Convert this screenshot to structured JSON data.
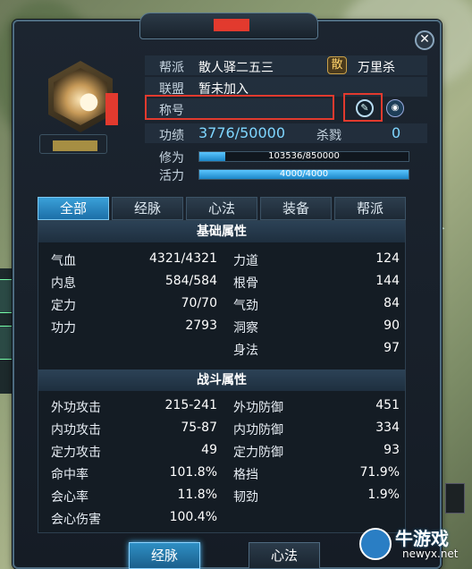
{
  "window": {
    "close_icon": "close-icon"
  },
  "profile": {
    "bangpai_label": "帮派",
    "bangpai_value": "散人驿二五三",
    "faction_badge": "散",
    "faction_name": "万里杀",
    "lianmeng_label": "联盟",
    "lianmeng_value": "暂未加入",
    "chenghao_label": "称号",
    "gongji_label": "功绩",
    "gongji_value": "3776/50000",
    "shalu_label": "杀戮",
    "shalu_value": "0",
    "xiuwei_label": "修为",
    "xiuwei_text": "103536/850000",
    "xiuwei_fraction": 0.1218,
    "huoli_label": "活力",
    "huoli_text": "4000/4000",
    "huoli_fraction": 1.0
  },
  "tabs": [
    "全部",
    "经脉",
    "心法",
    "装备",
    "帮派"
  ],
  "active_tab": 0,
  "basic": {
    "title": "基础属性",
    "left": [
      {
        "label": "气血",
        "value": "4321/4321"
      },
      {
        "label": "内息",
        "value": "584/584"
      },
      {
        "label": "定力",
        "value": "70/70"
      },
      {
        "label": "功力",
        "value": "2793"
      }
    ],
    "right": [
      {
        "label": "力道",
        "value": "124"
      },
      {
        "label": "根骨",
        "value": "144"
      },
      {
        "label": "气劲",
        "value": "84"
      },
      {
        "label": "洞察",
        "value": "90"
      },
      {
        "label": "身法",
        "value": "97"
      }
    ]
  },
  "combat": {
    "title": "战斗属性",
    "left": [
      {
        "label": "外功攻击",
        "value": "215-241"
      },
      {
        "label": "内功攻击",
        "value": "75-87"
      },
      {
        "label": "定力攻击",
        "value": "49"
      },
      {
        "label": "命中率",
        "value": "101.8%"
      },
      {
        "label": "会心率",
        "value": "11.8%"
      },
      {
        "label": "会心伤害",
        "value": "100.4%"
      }
    ],
    "right": [
      {
        "label": "外功防御",
        "value": "451"
      },
      {
        "label": "内功防御",
        "value": "334"
      },
      {
        "label": "定力防御",
        "value": "93"
      },
      {
        "label": "格挡",
        "value": "71.9%"
      },
      {
        "label": "韧劲",
        "value": "1.9%"
      }
    ]
  },
  "bottom": {
    "jingmai": "经脉",
    "xinfa": "心法"
  },
  "watermark": {
    "title": "牛游戏",
    "sub": "newyx.net"
  },
  "colors": {
    "accent": "#3aa0d8",
    "highlight_box": "#e23a2e",
    "value_blue": "#7fd6ff"
  }
}
